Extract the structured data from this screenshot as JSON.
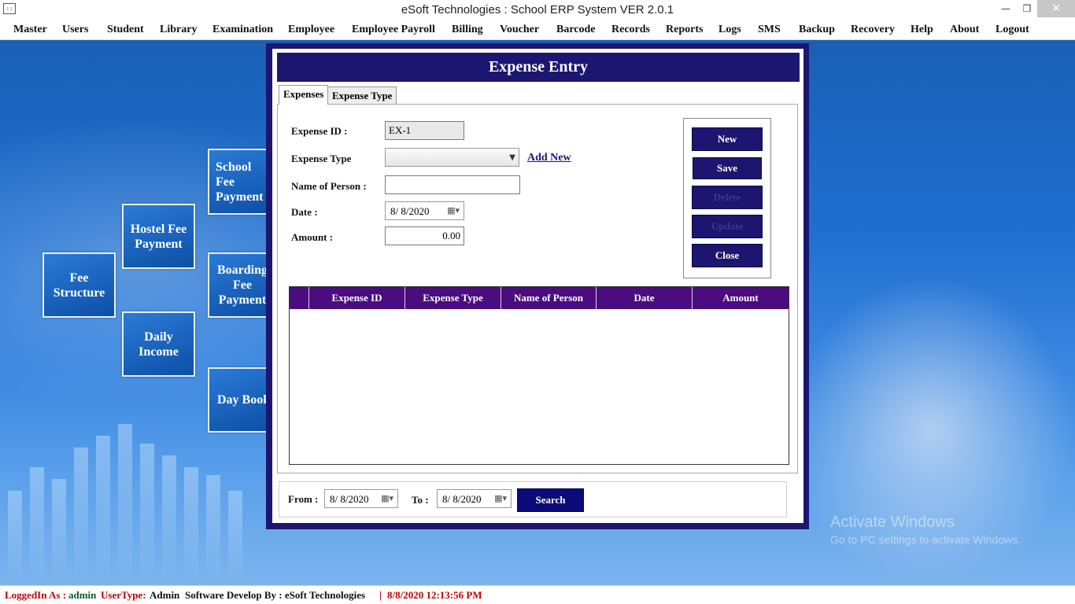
{
  "window": {
    "title": "eSoft Technologies : School ERP System VER 2.0.1",
    "app_icon": "app-icon",
    "controls": {
      "minimize": "—",
      "maximize": "❐",
      "close": "✕"
    }
  },
  "menubar": {
    "items": [
      "Master",
      "Users",
      "Student",
      "Library",
      "Examination",
      "Employee",
      "Employee Payroll",
      "Billing",
      "Voucher",
      "Barcode",
      "Records",
      "Reports",
      "Logs",
      "SMS",
      "Backup",
      "Recovery",
      "Help",
      "About",
      "Logout"
    ]
  },
  "tiles": {
    "fee_structure": "Fee Structure",
    "hostel_fee": "Hostel Fee Payment",
    "daily_income": "Daily Income",
    "school_fee": "School Fee Payment",
    "boarding_fee": "Boarding Fee Payment",
    "day_book": "Day Book"
  },
  "dialog": {
    "title": "Expense Entry",
    "tabs": [
      "Expenses",
      "Expense Type"
    ],
    "form": {
      "expense_id_label": "Expense ID :",
      "expense_id_value": "EX-1",
      "expense_type_label": "Expense Type",
      "expense_type_value": "",
      "add_new_link": "Add New",
      "person_label": "Name of Person :",
      "person_value": "",
      "date_label": "Date :",
      "date_value": "8/ 8/2020",
      "amount_label": "Amount :",
      "amount_value": "0.00"
    },
    "buttons": {
      "new": "New",
      "save": "Save",
      "delete": "Delete",
      "update": "Update",
      "close": "Close"
    },
    "grid": {
      "columns": [
        "Expense ID",
        "Expense Type",
        "Name of Person",
        "Date",
        "Amount"
      ],
      "rows": []
    },
    "search": {
      "from_label": "From :",
      "from_value": "8/ 8/2020",
      "to_label": "To :",
      "to_value": "8/ 8/2020",
      "button": "Search"
    }
  },
  "watermark": {
    "line1": "Activate Windows",
    "line2": "Go to PC settings to activate Windows."
  },
  "statusbar": {
    "logged_label": "LoggedIn As :",
    "logged_value": "admin",
    "usertype_label": "UserType:",
    "usertype_value": "Admin",
    "developer": "Software Develop By : eSoft Technologies",
    "separator": "|",
    "timestamp": "8/8/2020 12:13:56 PM"
  },
  "colors": {
    "dialog_navy": "#1c1670",
    "grid_header": "#4b0c80",
    "status_red": "#c00000",
    "status_green": "#0b5a2e"
  }
}
